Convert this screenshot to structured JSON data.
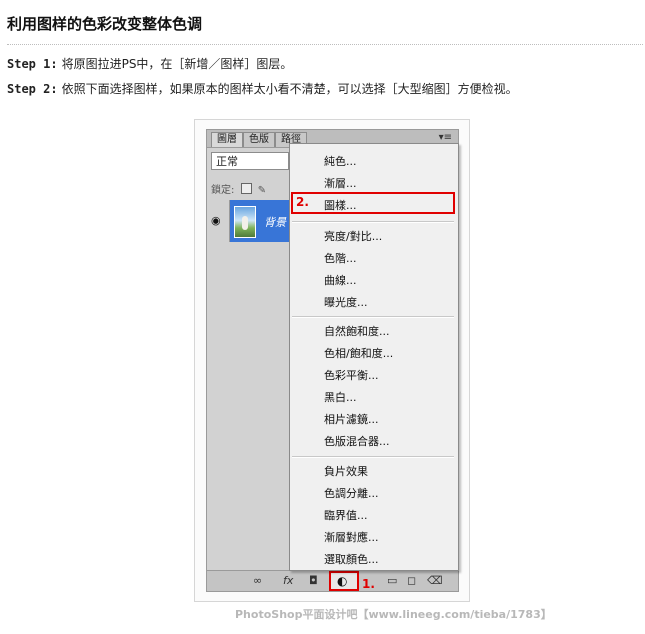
{
  "title": "利用图样的色彩改变整体色调",
  "steps": [
    {
      "label": "Step 1:",
      "text": "将原图拉进PS中，在［新增／图样］图层。"
    },
    {
      "label": "Step 2:",
      "text": "依照下面选择图样，如果原本的图样太小看不清楚，可以选择［大型缩图］方便检视。"
    }
  ],
  "panel": {
    "tabs": [
      "圖層",
      "色版",
      "路徑"
    ],
    "menu_glyph": "▾≡",
    "blend_mode": "正常",
    "lock_label": "鎖定:",
    "layer_name": "背景",
    "eye_icon": "eye-icon"
  },
  "menu": {
    "items": [
      "純色...",
      "漸層...",
      "圖樣...",
      "亮度/對比...",
      "色階...",
      "曲線...",
      "曝光度...",
      "自然飽和度...",
      "色相/飽和度...",
      "色彩平衡...",
      "黑白...",
      "相片濾鏡...",
      "色版混合器...",
      "負片效果",
      "色調分離...",
      "臨界值...",
      "漸層對應...",
      "選取顏色..."
    ],
    "highlight_color": "#e00000"
  },
  "annotations": {
    "one": "1.",
    "two": "2."
  },
  "watermark": "PhotoShop平面设计吧【www.lineeg.com/tieba/1783】"
}
